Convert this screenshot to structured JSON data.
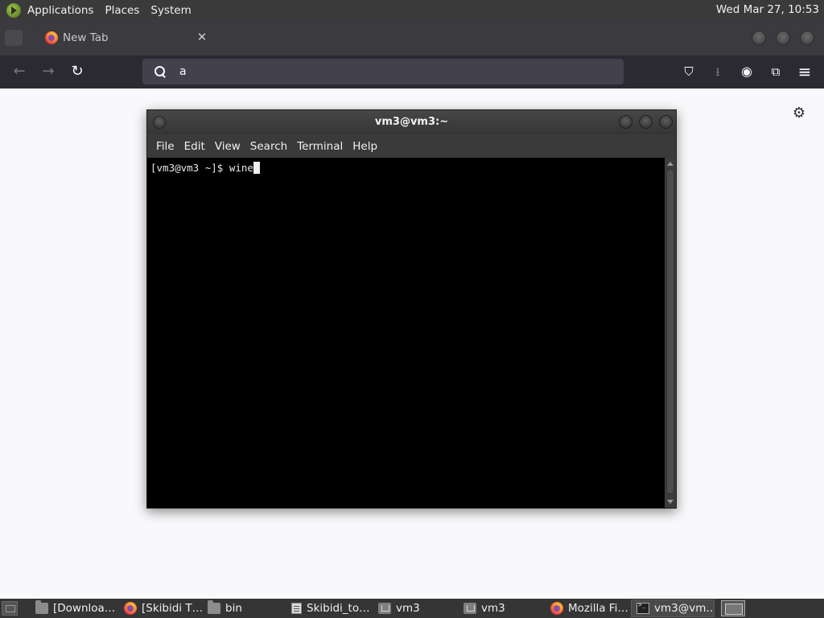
{
  "top_panel": {
    "menus": [
      "Applications",
      "Places",
      "System"
    ],
    "clock": "Wed Mar 27, 10:53"
  },
  "browser": {
    "tab": {
      "title": "New Tab",
      "close_glyph": "✕"
    },
    "url_text": "a",
    "icons": {
      "back": "←",
      "forward": "→",
      "reload": "↻",
      "pocket": "pocket-icon",
      "downloads": "download-icon",
      "account": "account-icon",
      "extensions": "extensions-icon",
      "menu": "hamburger-menu-icon",
      "settings": "gear-icon"
    },
    "glyphs": {
      "pocket": "⛉",
      "download": "⭳",
      "account": "◉",
      "extensions": "⧉",
      "menu": "≡",
      "gear": "⚙"
    }
  },
  "terminal": {
    "title": "vm3@vm3:~",
    "menu": [
      "File",
      "Edit",
      "View",
      "Search",
      "Terminal",
      "Help"
    ],
    "prompt": "[vm3@vm3 ~]$ ",
    "command": "wine"
  },
  "taskbar": {
    "items": [
      {
        "label": "[Downloa…",
        "icon": "folder-icon"
      },
      {
        "label": "[Skibidi T…",
        "icon": "firefox-icon"
      },
      {
        "label": "bin",
        "icon": "folder-icon"
      },
      {
        "label": "Skibidi_to…",
        "icon": "document-icon"
      },
      {
        "label": "vm3",
        "icon": "home-folder-icon"
      },
      {
        "label": "vm3",
        "icon": "home-folder-icon"
      },
      {
        "label": "Mozilla Fi…",
        "icon": "firefox-icon"
      },
      {
        "label": "vm3@vm…",
        "icon": "terminal-icon"
      }
    ]
  }
}
